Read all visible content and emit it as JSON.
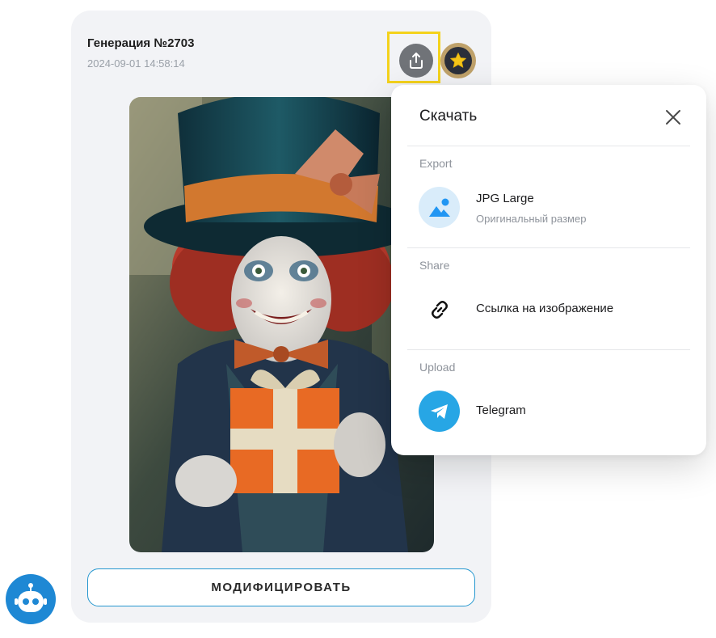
{
  "generation": {
    "title": "Генерация №2703",
    "date": "2024-09-01 14:58:14"
  },
  "actions": {
    "share_icon": "share-upload-icon",
    "favorite_icon": "star-icon",
    "modify_label": "МОДИФИЦИРОВАТЬ"
  },
  "artwork": {
    "description_icon": "generated-image"
  },
  "download_menu": {
    "title": "Скачать",
    "sections": [
      {
        "label": "Export",
        "option_title": "JPG Large",
        "option_subtitle": "Оригинальный размер",
        "icon": "image-icon"
      },
      {
        "label": "Share",
        "option_title": "Ссылка на изображение",
        "icon": "link-icon"
      },
      {
        "label": "Upload",
        "option_title": "Telegram",
        "icon": "telegram-icon"
      }
    ]
  },
  "colors": {
    "accent": "#2597cf",
    "highlight": "#f4d21c",
    "telegram": "#27a6e5",
    "bot": "#1e88d4"
  }
}
